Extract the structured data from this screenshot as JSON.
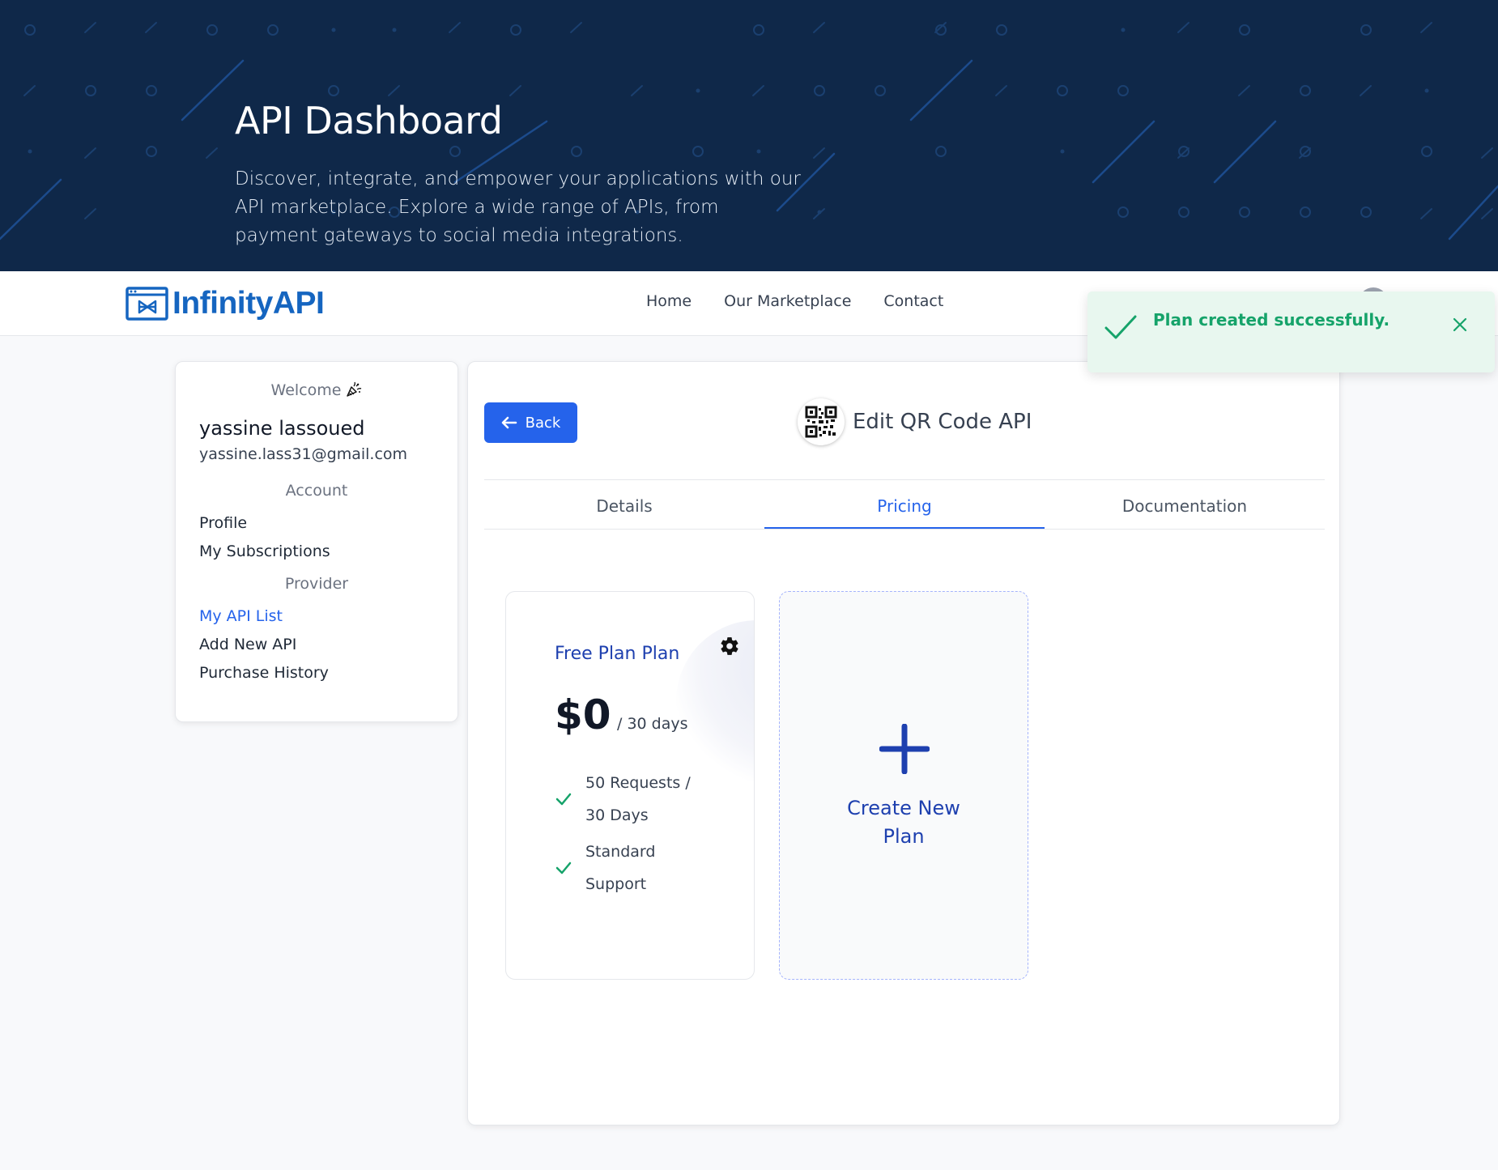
{
  "hero": {
    "title": "API Dashboard",
    "description": "Discover, integrate, and empower your applications with our API marketplace. Explore a wide range of APIs, from payment gateways to social media integrations.",
    "bg_color": "#0f2849"
  },
  "navbar": {
    "brand": "InfinityAPI",
    "links": [
      "Home",
      "Our Marketplace",
      "Contact"
    ]
  },
  "sidebar": {
    "welcome": "Welcome",
    "user_name": "yassine lassoued",
    "user_email": "yassine.lass31@gmail.com",
    "account_label": "Account",
    "account_items": [
      "Profile",
      "My Subscriptions"
    ],
    "provider_label": "Provider",
    "provider_items": [
      "My API List",
      "Add New API",
      "Purchase History"
    ],
    "active_item": "My API List"
  },
  "main": {
    "back_label": "Back",
    "api_title": "Edit QR Code API",
    "tabs": [
      "Details",
      "Pricing",
      "Documentation"
    ],
    "active_tab": "Pricing",
    "plans": [
      {
        "name": "Free Plan Plan",
        "price": "$0",
        "period": "/ 30 days",
        "features": [
          [
            "50 Requests /",
            "30 Days"
          ],
          [
            "Standard",
            "Support"
          ]
        ]
      }
    ],
    "create_label_line1": "Create New",
    "create_label_line2": "Plan"
  },
  "toast": {
    "message": "Plan created successfully.",
    "color": "#16a36a"
  },
  "colors": {
    "primary": "#2563eb",
    "plan_text": "#1e40af",
    "success": "#16a36a"
  }
}
